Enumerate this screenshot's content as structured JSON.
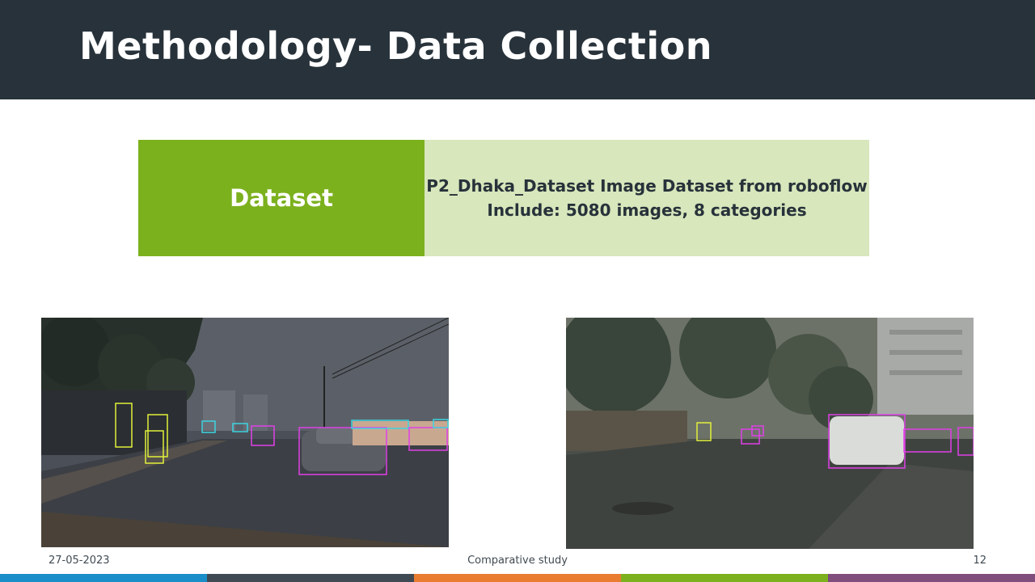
{
  "slide": {
    "title": "Methodology- Data Collection"
  },
  "info_table": {
    "label": "Dataset",
    "line1": "P2_Dhaka_Dataset Image Dataset from roboflow",
    "line2": "Include: 5080 images, 8 categories"
  },
  "footer": {
    "date": "27-05-2023",
    "center_text": "Comparative study",
    "page_number": "12"
  },
  "theme": {
    "title_bar": "#27323a",
    "label_cell": "#7cb11e",
    "value_cell": "#d8e7bc",
    "strip_colors": [
      "#1a8ec9",
      "#404a52",
      "#e97c30",
      "#7cb11e",
      "#7f4e7d"
    ]
  }
}
